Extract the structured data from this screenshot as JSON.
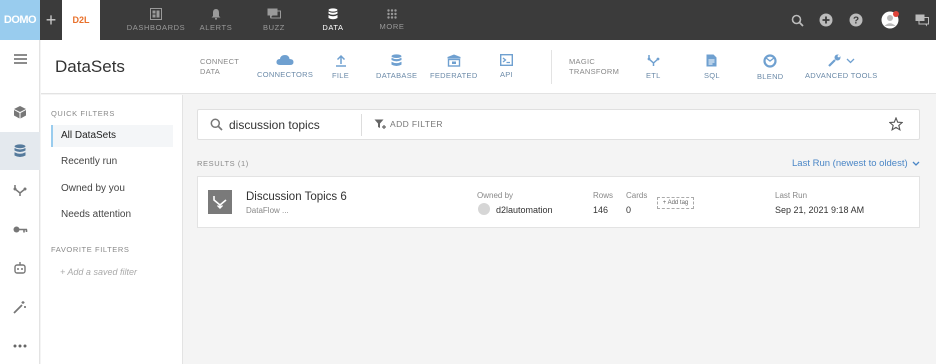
{
  "topbar": {
    "logo": "DOMO",
    "brand_tab": "D2L",
    "nav": [
      {
        "label": "DASHBOARDS",
        "icon": "dashboards-icon"
      },
      {
        "label": "ALERTS",
        "icon": "bell-icon"
      },
      {
        "label": "BUZZ",
        "icon": "chat-icon"
      },
      {
        "label": "DATA",
        "icon": "database-icon",
        "active": true
      },
      {
        "label": "MORE",
        "icon": "grid-icon"
      }
    ],
    "right_icons": [
      "search-icon",
      "add-circle-icon",
      "help-icon",
      "user-avatar",
      "messages-icon"
    ],
    "notification_color": "#e0443a"
  },
  "rail": {
    "items": [
      "cube-icon",
      "database-icon",
      "dataflow-icon",
      "key-icon",
      "robot-icon",
      "magic-wand-icon",
      "more-icon"
    ],
    "active": "database-icon"
  },
  "header": {
    "title": "DataSets",
    "connect_label_1": "CONNECT",
    "connect_label_2": "DATA",
    "connect_tools": [
      "CONNECTORS",
      "FILE",
      "DATABASE",
      "FEDERATED",
      "API"
    ],
    "magic_label_1": "MAGIC",
    "magic_label_2": "TRANSFORM",
    "magic_tools": [
      "ETL",
      "SQL",
      "BLEND",
      "ADVANCED TOOLS"
    ]
  },
  "filters": {
    "quick_heading": "QUICK FILTERS",
    "items": [
      "All DataSets",
      "Recently run",
      "Owned by you",
      "Needs attention"
    ],
    "active_index": 0,
    "favorite_heading": "FAVORITE FILTERS",
    "add_saved": "+ Add a saved filter"
  },
  "search": {
    "value": "discussion topics",
    "add_filter": "ADD FILTER"
  },
  "results": {
    "count_label": "RESULTS (1)",
    "sort_label": "Last Run (newest to oldest)",
    "items": [
      {
        "name": "Discussion Topics 6",
        "type": "DataFlow ...",
        "owned_by_label": "Owned by",
        "owner": "d2lautomation",
        "rows_label": "Rows",
        "rows": "146",
        "cards_label": "Cards",
        "cards": "0",
        "add_tag": "+ Add tag",
        "last_run_label": "Last Run",
        "last_run": "Sep 21, 2021 9:18 AM"
      }
    ]
  },
  "colors": {
    "accent": "#99ccee",
    "link": "#4a86c6",
    "brand": "#e8702a",
    "topbar": "#3b3b3b"
  }
}
